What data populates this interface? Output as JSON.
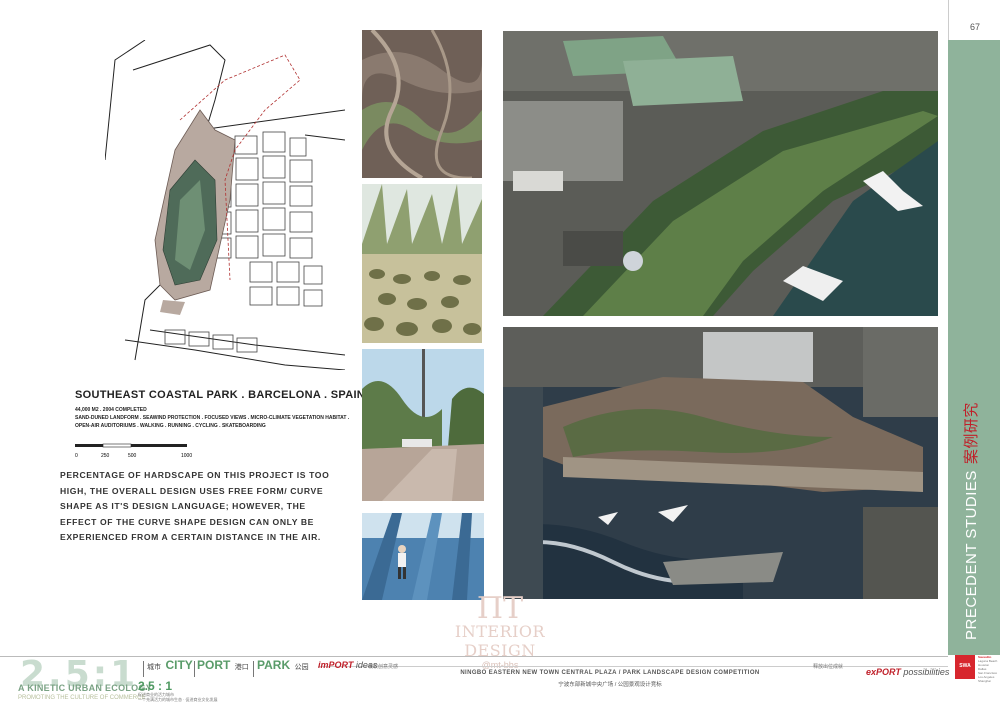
{
  "page": {
    "number": "67"
  },
  "sidebar": {
    "title_en": "PRECEDENT STUDIES",
    "title_cn": "案例研究"
  },
  "brand": {
    "logo": "SWA",
    "lines": [
      "Sausalito",
      "Laguna Beach",
      "Houston",
      "Dallas",
      "San Francisco",
      "Los Angeles",
      "Shanghai"
    ]
  },
  "project": {
    "title": "SOUTHEAST COASTAL PARK . BARCELONA . SPAIN",
    "info_lines": [
      "44,000 M2 . 2004 COMPLETED",
      "SAND-DUNED LANDFORM . SEAWIND PROTECTION . FOCUSED VIEWS . MICRO-CLIMATE VEGETATION HABITAT .",
      "OPEN-AIR AUDITORIUMS . WALKING . RUNNING . CYCLING . SKATEBOARDING"
    ],
    "scale_labels": [
      "0",
      "250",
      "500",
      "1000"
    ]
  },
  "body_text": "Percentage of hardscape on this project is too high, the overall design uses free form/ curve shape as it's design language; however, the effect of the curve shape design can only be experienced from a certain distance in the air.",
  "watermark": {
    "logo": "ПТ",
    "text": "INTERIOR DESIGN",
    "handle": "@mt-bbs"
  },
  "footer": {
    "big_num": "2.5:1",
    "tagline": "A KINETIC URBAN ECOLOGY",
    "subline": "PROMOTING THE CULTURE OF COMMERCE",
    "small_num": "2.5 : 1",
    "small_cn": [
      "促进商业的活力城市",
      "一个充满活力的城市生态 · 促进商业文化发展"
    ],
    "nav": [
      {
        "en": "CITY",
        "cn": "城市"
      },
      {
        "en": "PORT",
        "cn": "港口"
      },
      {
        "en": "PARK",
        "cn": "公园"
      }
    ],
    "import_prefix": "imPORT",
    "import_suffix": " ideas",
    "import_cn": "吸收创意灵感",
    "export_prefix": "exPORT",
    "export_suffix": " possibilities",
    "export_cn": "释放出位成就",
    "competition": "NINGBO EASTERN NEW TOWN CENTRAL PLAZA / PARK LANDSCAPE DESIGN COMPETITION",
    "competition_cn": "宁波东部新城中央广场 / 公园景观设计竞标"
  },
  "colors": {
    "accent_green": "#8fb39b",
    "accent_red": "#c0202a",
    "logo_red": "#d7262e"
  }
}
